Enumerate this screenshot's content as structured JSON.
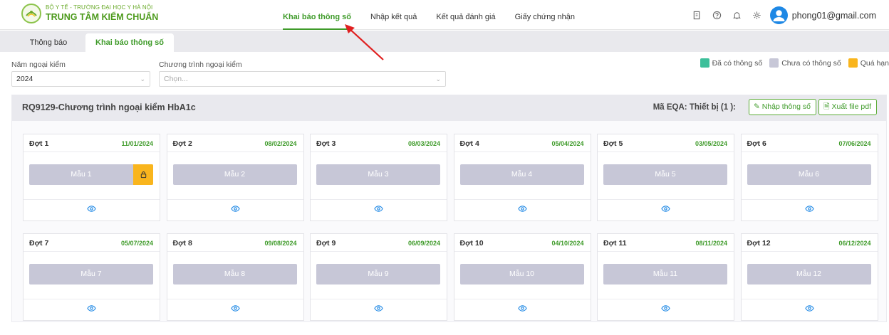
{
  "header": {
    "org_top": "BỘ Y TẾ - TRƯỜNG ĐẠI HỌC Y HÀ NỘI",
    "org_main": "TRUNG TÂM KIỂM CHUẨN",
    "nav": [
      {
        "label": "Khai báo thông số",
        "active": true
      },
      {
        "label": "Nhập kết quả",
        "active": false
      },
      {
        "label": "Kết quả đánh giá",
        "active": false
      },
      {
        "label": "Giấy chứng nhận",
        "active": false
      }
    ],
    "tool_icons": [
      "document-icon",
      "help-icon",
      "bell-icon",
      "settings-icon"
    ],
    "user_email": "phong01@gmail.com"
  },
  "tabs": [
    {
      "label": "Thông báo",
      "active": false
    },
    {
      "label": "Khai báo thông số",
      "active": true
    }
  ],
  "filters": {
    "year_label": "Năm ngoại kiểm",
    "year_value": "2024",
    "program_label": "Chương trình ngoại kiểm",
    "program_placeholder": "Chọn..."
  },
  "legend": [
    {
      "label": "Đã có thông số",
      "color": "#3cbf9a"
    },
    {
      "label": "Chưa có thông số",
      "color": "#c7c7d7"
    },
    {
      "label": "Quá hạn",
      "color": "#f9b51d"
    }
  ],
  "panel": {
    "title": "RQ9129-Chương trình ngoại kiểm HbA1c",
    "eqa_label": "Mã EQA: Thiết bị (1 ):",
    "btn_enter": "Nhập thông số",
    "btn_export": "Xuất file pdf"
  },
  "rounds": [
    {
      "name": "Đợt 1",
      "date": "11/01/2024",
      "sample": "Mẫu 1",
      "locked": true
    },
    {
      "name": "Đợt 2",
      "date": "08/02/2024",
      "sample": "Mẫu 2",
      "locked": false
    },
    {
      "name": "Đợt 3",
      "date": "08/03/2024",
      "sample": "Mẫu 3",
      "locked": false
    },
    {
      "name": "Đợt 4",
      "date": "05/04/2024",
      "sample": "Mẫu 4",
      "locked": false
    },
    {
      "name": "Đợt 5",
      "date": "03/05/2024",
      "sample": "Mẫu 5",
      "locked": false
    },
    {
      "name": "Đợt 6",
      "date": "07/06/2024",
      "sample": "Mẫu 6",
      "locked": false
    },
    {
      "name": "Đợt 7",
      "date": "05/07/2024",
      "sample": "Mẫu 7",
      "locked": false
    },
    {
      "name": "Đợt 8",
      "date": "09/08/2024",
      "sample": "Mẫu 8",
      "locked": false
    },
    {
      "name": "Đợt 9",
      "date": "06/09/2024",
      "sample": "Mẫu 9",
      "locked": false
    },
    {
      "name": "Đợt 10",
      "date": "04/10/2024",
      "sample": "Mẫu 10",
      "locked": false
    },
    {
      "name": "Đợt 11",
      "date": "08/11/2024",
      "sample": "Mẫu 11",
      "locked": false
    },
    {
      "name": "Đợt 12",
      "date": "06/12/2024",
      "sample": "Mẫu 12",
      "locked": false
    }
  ],
  "colors": {
    "brand_green": "#3f9b2a",
    "sample_pending": "#c7c7d7",
    "overdue": "#f9b51d",
    "annotation_arrow": "#e02020"
  }
}
